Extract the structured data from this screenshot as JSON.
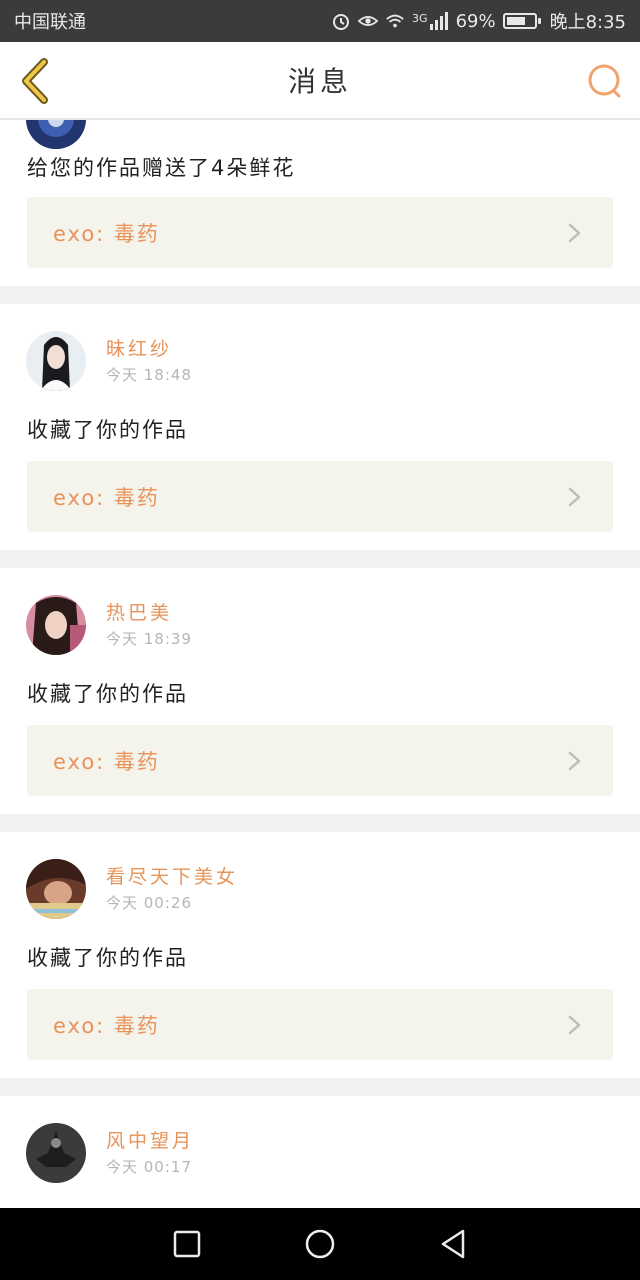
{
  "status_bar": {
    "carrier": "中国联通",
    "network": "3G",
    "battery_percent": "69%",
    "battery_level": 0.69,
    "time": "晚上8:35"
  },
  "header": {
    "title": "消息",
    "back_icon": "chevron-left-icon",
    "search_icon": "search-icon"
  },
  "notifications": [
    {
      "action": "给您的作品赠送了4朵鲜花",
      "work_title": "exo: 毒药"
    },
    {
      "username": "昧红纱",
      "time": "今天 18:48",
      "action": "收藏了你的作品",
      "work_title": "exo: 毒药"
    },
    {
      "username": "热巴美",
      "time": "今天 18:39",
      "action": "收藏了你的作品",
      "work_title": "exo: 毒药"
    },
    {
      "username": "看尽天下美女",
      "time": "今天 00:26",
      "action": "收藏了你的作品",
      "work_title": "exo: 毒药"
    },
    {
      "username": "风中望月",
      "time": "今天 00:17"
    }
  ],
  "colors": {
    "accent": "#e7935a",
    "card_bg": "#ffffff",
    "page_bg": "#f3f2f0",
    "work_box_bg": "#f4f3ec"
  },
  "nav_bar": {
    "recent_icon": "square-icon",
    "home_icon": "circle-icon",
    "back_icon": "triangle-back-icon"
  }
}
